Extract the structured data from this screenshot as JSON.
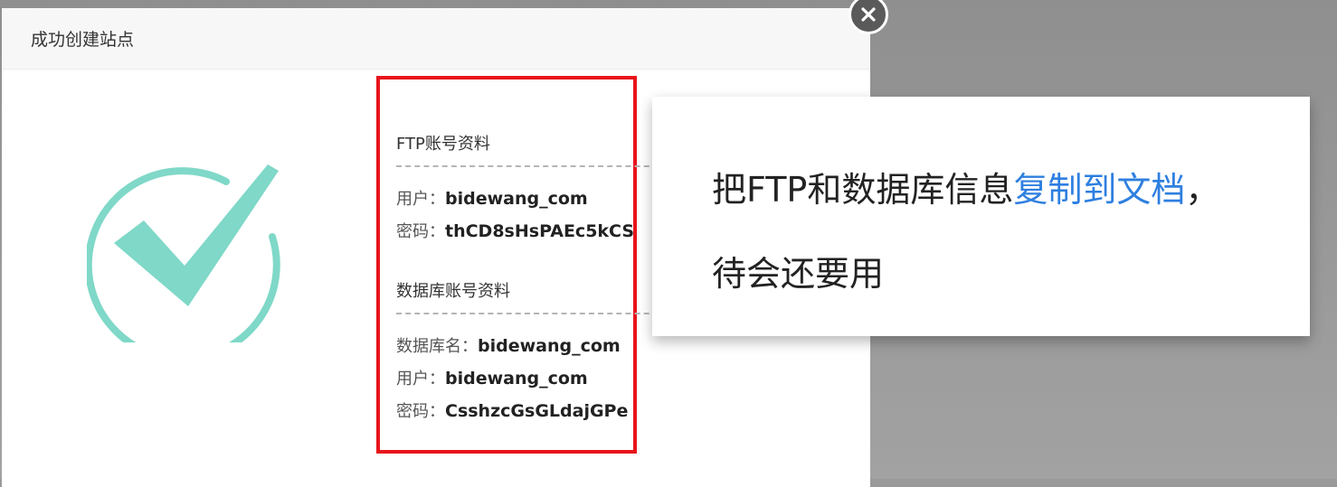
{
  "dialog": {
    "title": "成功创建站点",
    "close_icon": "close-icon",
    "success_icon": "check-circle-icon",
    "colors": {
      "success": "#7fd8c8",
      "highlight_border": "#e8141b",
      "link": "#2e7fe0"
    }
  },
  "ftp": {
    "section_title": "FTP账号资料",
    "user_label": "用户：",
    "user_value": "bidewang_com",
    "password_label": "密码：",
    "password_value": "thCD8sHsPAEc5kCS"
  },
  "db": {
    "section_title": "数据库账号资料",
    "name_label": "数据库名：",
    "name_value": "bidewang_com",
    "user_label": "用户：",
    "user_value": "bidewang_com",
    "password_label": "密码：",
    "password_value": "CsshzcGsGLdajGPe"
  },
  "hint": {
    "prefix": "把FTP和数据库信息",
    "highlight": "复制到文档",
    "suffix": "，",
    "line2": "待会还要用"
  }
}
